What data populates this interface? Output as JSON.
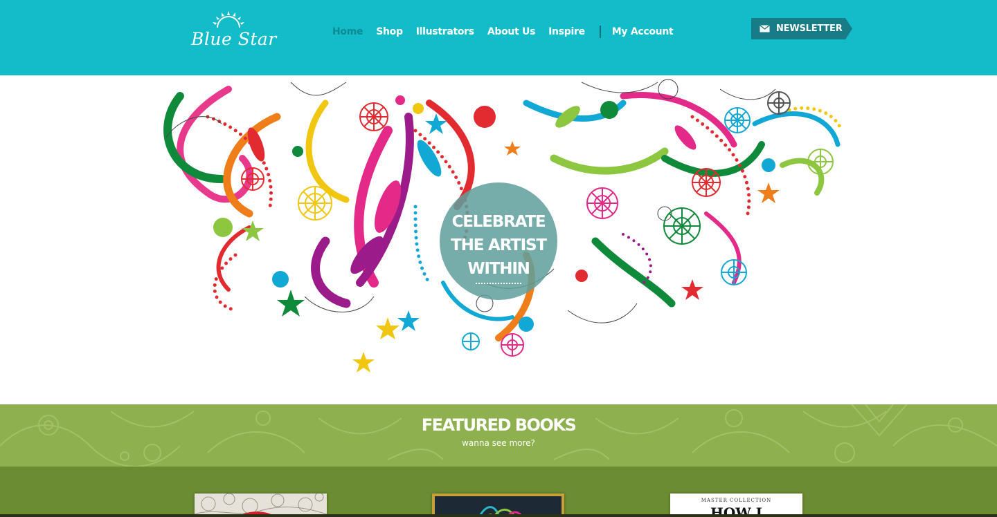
{
  "brand": {
    "name": "Blue Star",
    "colors": {
      "header": "#12bcc9",
      "nav_active": "#0c8a94",
      "newsletter": "#187c86",
      "featured": "#8fb04f",
      "books_bg": "#6b8c32"
    }
  },
  "nav": {
    "items": [
      {
        "label": "Home",
        "active": true
      },
      {
        "label": "Shop",
        "active": false
      },
      {
        "label": "Illustrators",
        "active": false
      },
      {
        "label": "About Us",
        "active": false
      },
      {
        "label": "Inspire",
        "active": false
      }
    ],
    "account_label": "My Account"
  },
  "newsletter": {
    "label": "NEWSLETTER",
    "icon": "envelope-icon"
  },
  "hero": {
    "badge_lines": [
      "CELEBRATE",
      "THE ARTIST",
      "WITHIN"
    ]
  },
  "featured": {
    "title": "FEATURED BOOKS",
    "subtitle": "wanna see more?"
  },
  "books": [
    {
      "cover_text": ""
    },
    {
      "cover_text": ""
    },
    {
      "cover_series": "MASTER COLLECTION",
      "cover_title": "HOW I"
    }
  ]
}
